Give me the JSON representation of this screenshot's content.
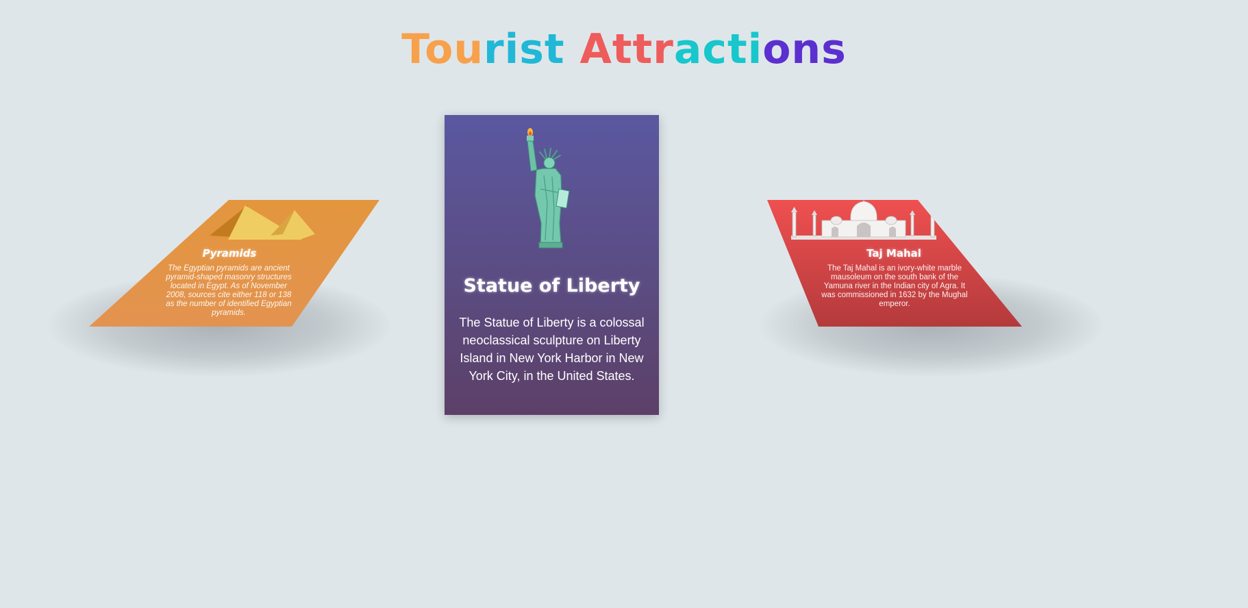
{
  "page": {
    "title_segments": [
      {
        "text": "Tou",
        "color": "#f7a14c"
      },
      {
        "text": "rist ",
        "color": "#20b8d6"
      },
      {
        "text": "Attr",
        "color": "#ee5c5c"
      },
      {
        "text": "acti",
        "color": "#17c7cc"
      },
      {
        "text": "ons",
        "color": "#5b2fd0"
      }
    ]
  },
  "cards": {
    "left": {
      "icon": "pyramids-icon",
      "title": "Pyramids",
      "description": "The Egyptian pyramids are ancient pyramid-shaped masonry structures located in Egypt. As of November 2008, sources cite either 118 or 138 as the number of identified Egyptian pyramids.",
      "color": "#e3963d"
    },
    "center": {
      "icon": "statue-of-liberty-icon",
      "title": "Statue of Liberty",
      "description": "The Statue of Liberty is a colossal neoclassical sculpture on Liberty Island in New York Harbor in New York City, in the United States.",
      "color": "#5b58a0"
    },
    "right": {
      "icon": "taj-mahal-icon",
      "title": "Taj Mahal",
      "description": "The Taj Mahal is an ivory-white marble mausoleum on the south bank of the Yamuna river in the Indian city of Agra. It was commissioned in 1632 by the Mughal emperor.",
      "color": "#ef5050"
    }
  }
}
